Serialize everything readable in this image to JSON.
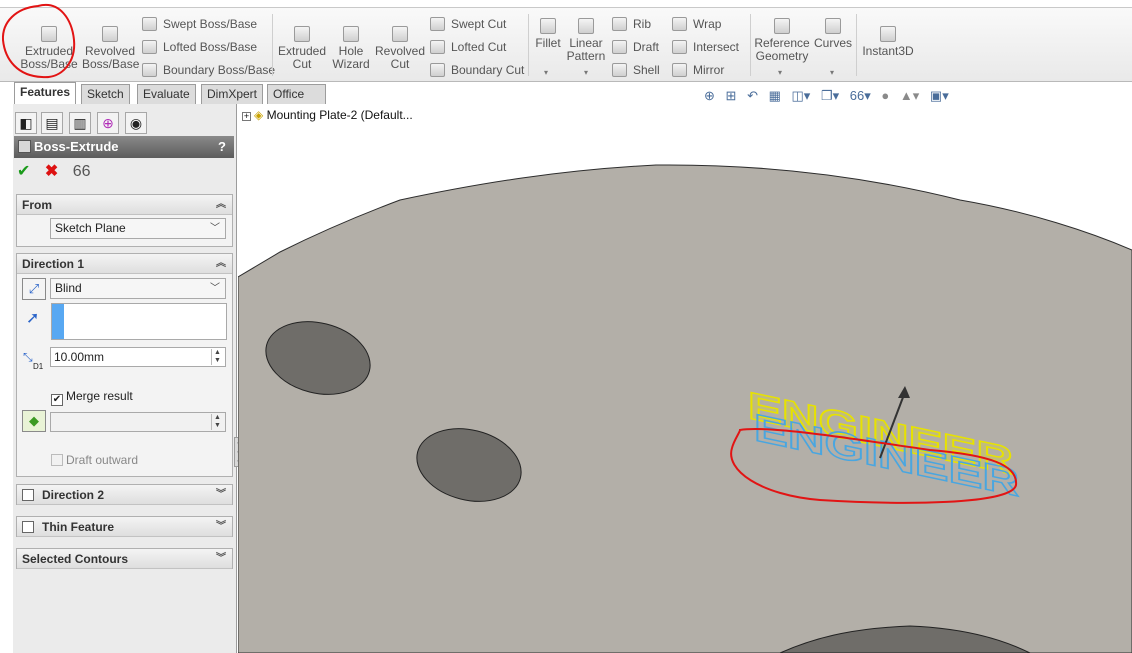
{
  "ribbon": {
    "extruded_boss": [
      "Extruded",
      "Boss/Base"
    ],
    "revolved_boss": [
      "Revolved",
      "Boss/Base"
    ],
    "swept_boss": "Swept Boss/Base",
    "lofted_boss": "Lofted Boss/Base",
    "boundary_boss": "Boundary Boss/Base",
    "extruded_cut": [
      "Extruded",
      "Cut"
    ],
    "hole_wizard": [
      "Hole",
      "Wizard"
    ],
    "revolved_cut": [
      "Revolved",
      "Cut"
    ],
    "swept_cut": "Swept Cut",
    "lofted_cut": "Lofted Cut",
    "boundary_cut": "Boundary Cut",
    "fillet": "Fillet",
    "linear_pattern": [
      "Linear",
      "Pattern"
    ],
    "rib": "Rib",
    "draft": "Draft",
    "shell": "Shell",
    "wrap": "Wrap",
    "intersect": "Intersect",
    "mirror": "Mirror",
    "reference_geometry": [
      "Reference",
      "Geometry"
    ],
    "curves": "Curves",
    "instant3d": "Instant3D"
  },
  "tabs": [
    "Features",
    "Sketch",
    "Evaluate",
    "DimXpert",
    "Office Products"
  ],
  "tree": {
    "root_label": "Mounting Plate-2  (Default..."
  },
  "property_manager": {
    "title": "Boss-Extrude",
    "help": "?",
    "from": {
      "header": "From",
      "value": "Sketch Plane"
    },
    "direction1": {
      "header": "Direction 1",
      "end_condition": "Blind",
      "depth": "10.00mm",
      "depth_label": "D1",
      "merge_result": "Merge result",
      "merge_checked": true,
      "draft_outward": "Draft outward"
    },
    "direction2": "Direction 2",
    "thin_feature": "Thin Feature",
    "selected_contours": "Selected Contours"
  },
  "model_text": "ENGINEER",
  "colors": {
    "plate": "#b3afa8",
    "hole": "#6f6d69",
    "preview_yellow": "#e7e200",
    "preview_blue": "#49a6e0",
    "annotation_red": "#e21414"
  }
}
